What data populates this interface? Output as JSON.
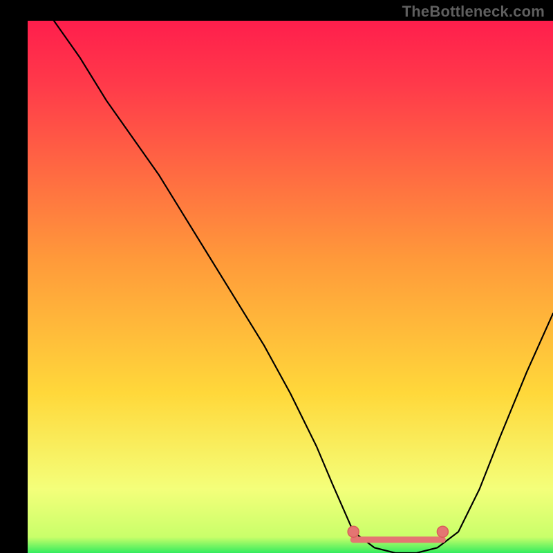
{
  "watermark": "TheBottleneck.com",
  "colors": {
    "bg": "#000000",
    "curve": "#000000",
    "marker_fill": "#e47572",
    "marker_stroke": "#d85c59",
    "grad_top": "#ff1e4c",
    "grad_mid": "#ffd83a",
    "grad_low": "#f4ff7a",
    "grad_bottom": "#33ec5e"
  },
  "chart_data": {
    "type": "line",
    "title": "",
    "xlabel": "",
    "ylabel": "",
    "xlim": [
      0,
      100
    ],
    "ylim": [
      0,
      100
    ],
    "grid": false,
    "legend": false,
    "note": "Axes are unlabeled; values are read as percentage of the plot area (0–100). The curve resembles a bottleneck profile: a steep drop from ~x=5 where y≈100 down to a flat minimum near y≈0 around x≈62–79, then rising back up toward x=100 where y≈45. Two red marker clusters sit at each end of the flat minimum and a red horizontal segment connects them along the bottom.",
    "series": [
      {
        "name": "bottleneck-curve",
        "x": [
          5,
          10,
          15,
          20,
          25,
          30,
          35,
          40,
          45,
          50,
          55,
          58,
          62,
          66,
          70,
          74,
          78,
          82,
          86,
          90,
          95,
          100
        ],
        "y": [
          100,
          93,
          85,
          78,
          71,
          63,
          55,
          47,
          39,
          30,
          20,
          13,
          4,
          1,
          0,
          0,
          1,
          4,
          12,
          22,
          34,
          45
        ]
      }
    ],
    "markers": [
      {
        "name": "min-start",
        "x": 62,
        "y": 4
      },
      {
        "name": "min-end",
        "x": 79,
        "y": 4
      }
    ],
    "min_segment": {
      "x0": 62,
      "x1": 79,
      "y": 2.5
    }
  }
}
